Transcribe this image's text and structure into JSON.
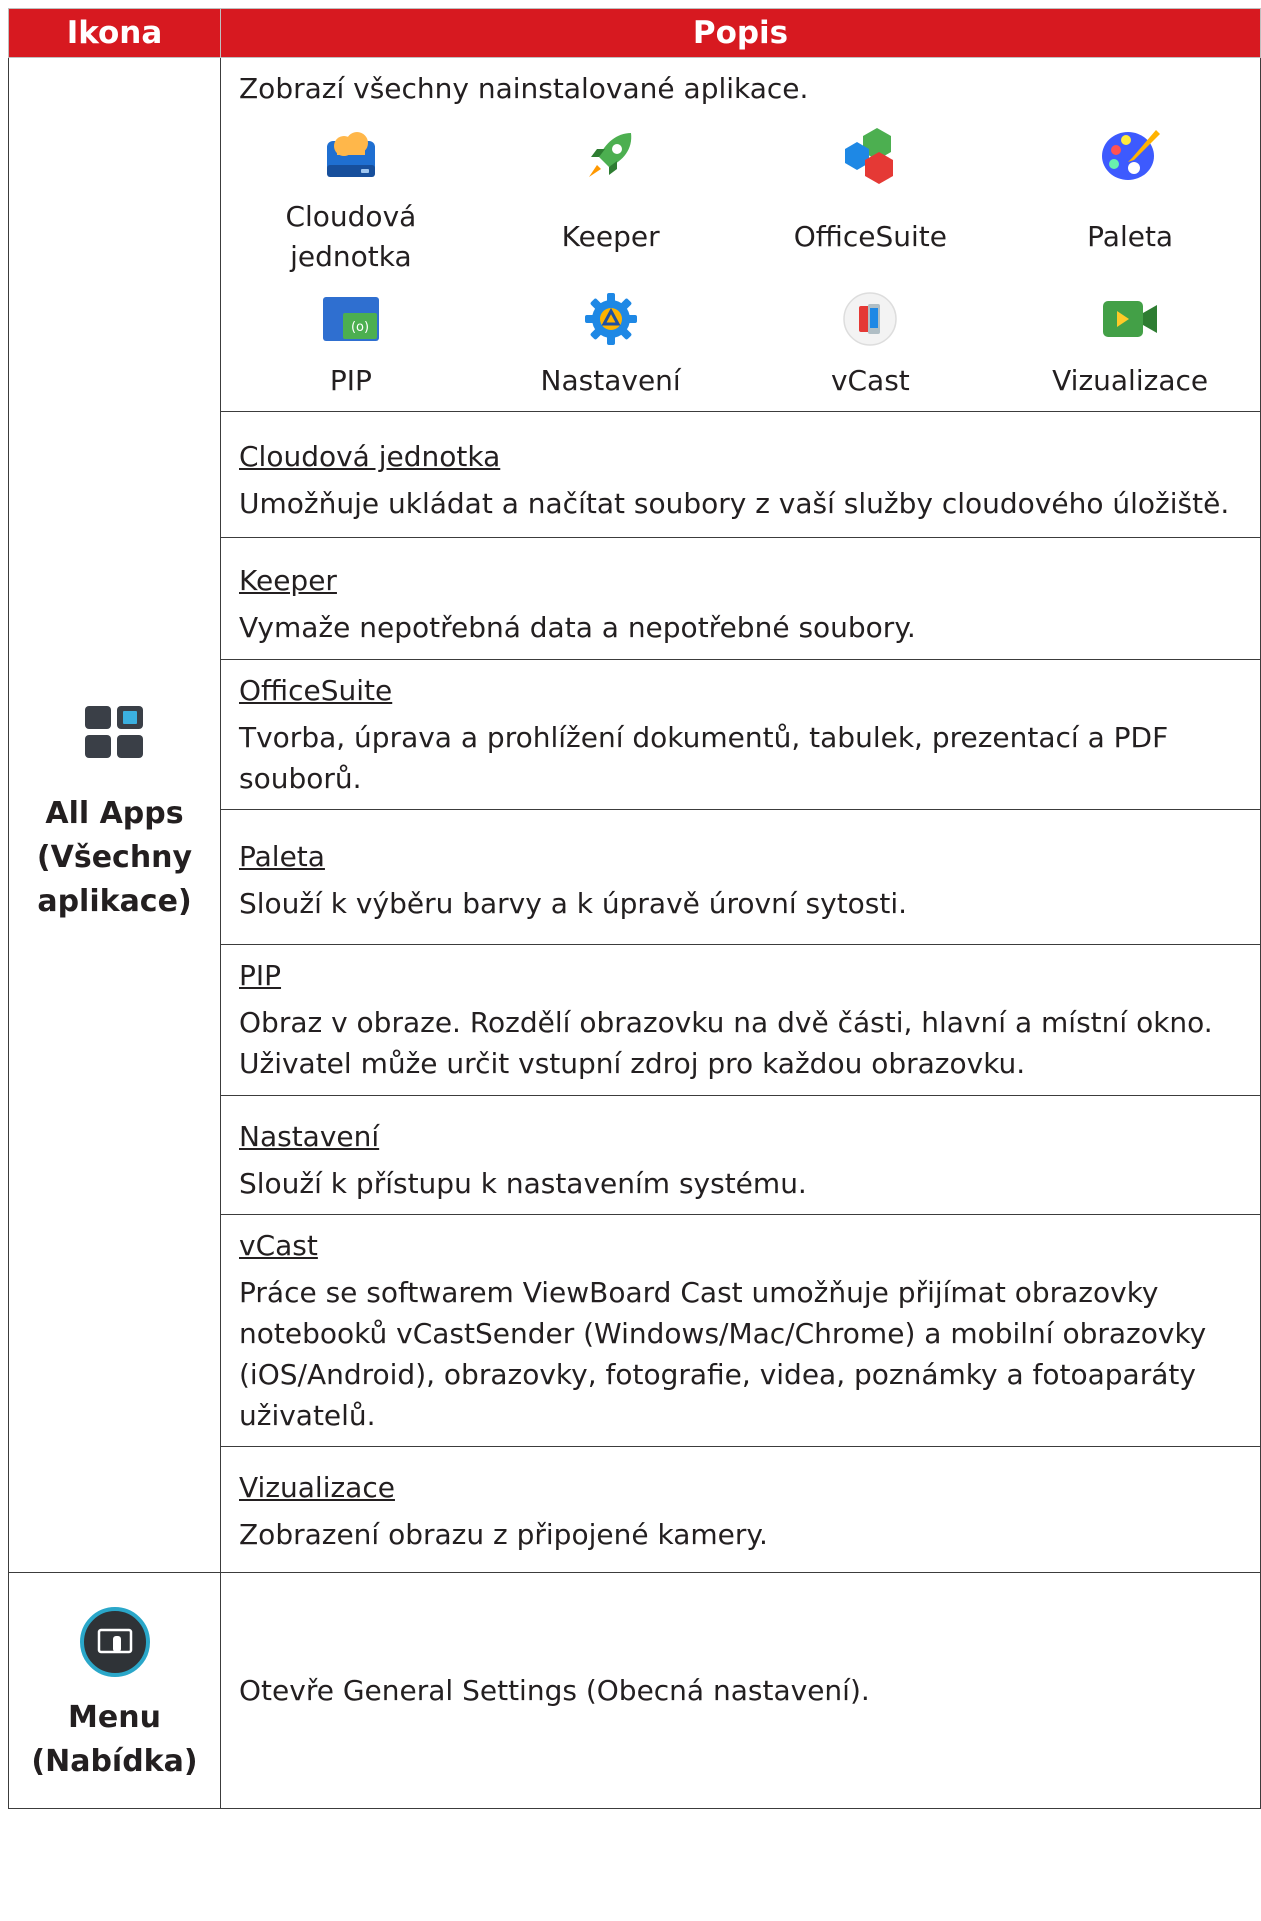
{
  "header": {
    "icon_col": "Ikona",
    "desc_col": "Popis"
  },
  "all_apps": {
    "icon_name": "all-apps-grid-icon",
    "label_line1": "All Apps",
    "label_line2": "(Všechny",
    "label_line3": "aplikace)",
    "intro": "Zobrazí všechny nainstalované aplikace.",
    "apps": [
      {
        "label": "Cloudová jednotka",
        "icon": "cloud-drive-icon"
      },
      {
        "label": "Keeper",
        "icon": "rocket-icon"
      },
      {
        "label": "OfficeSuite",
        "icon": "officesuite-icon"
      },
      {
        "label": "Paleta",
        "icon": "palette-icon"
      },
      {
        "label": "PIP",
        "icon": "pip-icon"
      },
      {
        "label": "Nastavení",
        "icon": "settings-gear-icon"
      },
      {
        "label": "vCast",
        "icon": "vcast-icon"
      },
      {
        "label": "Vizualizace",
        "icon": "video-camera-icon"
      }
    ],
    "sections": [
      {
        "title": "Cloudová jednotka",
        "text": "Umožňuje ukládat a načítat soubory z vaší služby cloudového úložiště."
      },
      {
        "title": "Keeper",
        "text": "Vymaže nepotřebná data a nepotřebné soubory."
      },
      {
        "title": "OfficeSuite",
        "text": "Tvorba, úprava a prohlížení dokumentů, tabulek, prezentací a PDF souborů."
      },
      {
        "title": "Paleta",
        "text": "Slouží k výběru barvy a k úpravě úrovní sytosti."
      },
      {
        "title": "PIP",
        "text": "Obraz v obraze. Rozdělí obrazovku na dvě části, hlavní a místní okno. Uživatel může určit vstupní zdroj pro každou obrazovku."
      },
      {
        "title": "Nastavení",
        "text": "Slouží k přístupu k nastavením systému."
      },
      {
        "title": "vCast",
        "text": "Práce se softwarem ViewBoard Cast umožňuje přijímat obrazovky notebooků vCastSender (Windows/Mac/Chrome) a mobilní obrazovky (iOS/Android), obrazovky, fotografie, videa, poznámky a fotoaparáty uživatelů."
      },
      {
        "title": "Vizualizace",
        "text": "Zobrazení obrazu z připojené kamery."
      }
    ]
  },
  "menu": {
    "icon_name": "menu-touch-icon",
    "label_line1": "Menu",
    "label_line2": "(Nabídka)",
    "text": "Otevře General Settings (Obecná nastavení)."
  },
  "colors": {
    "header_bg": "#d71920",
    "header_text": "#ffffff",
    "border": "#3c3c3c"
  }
}
